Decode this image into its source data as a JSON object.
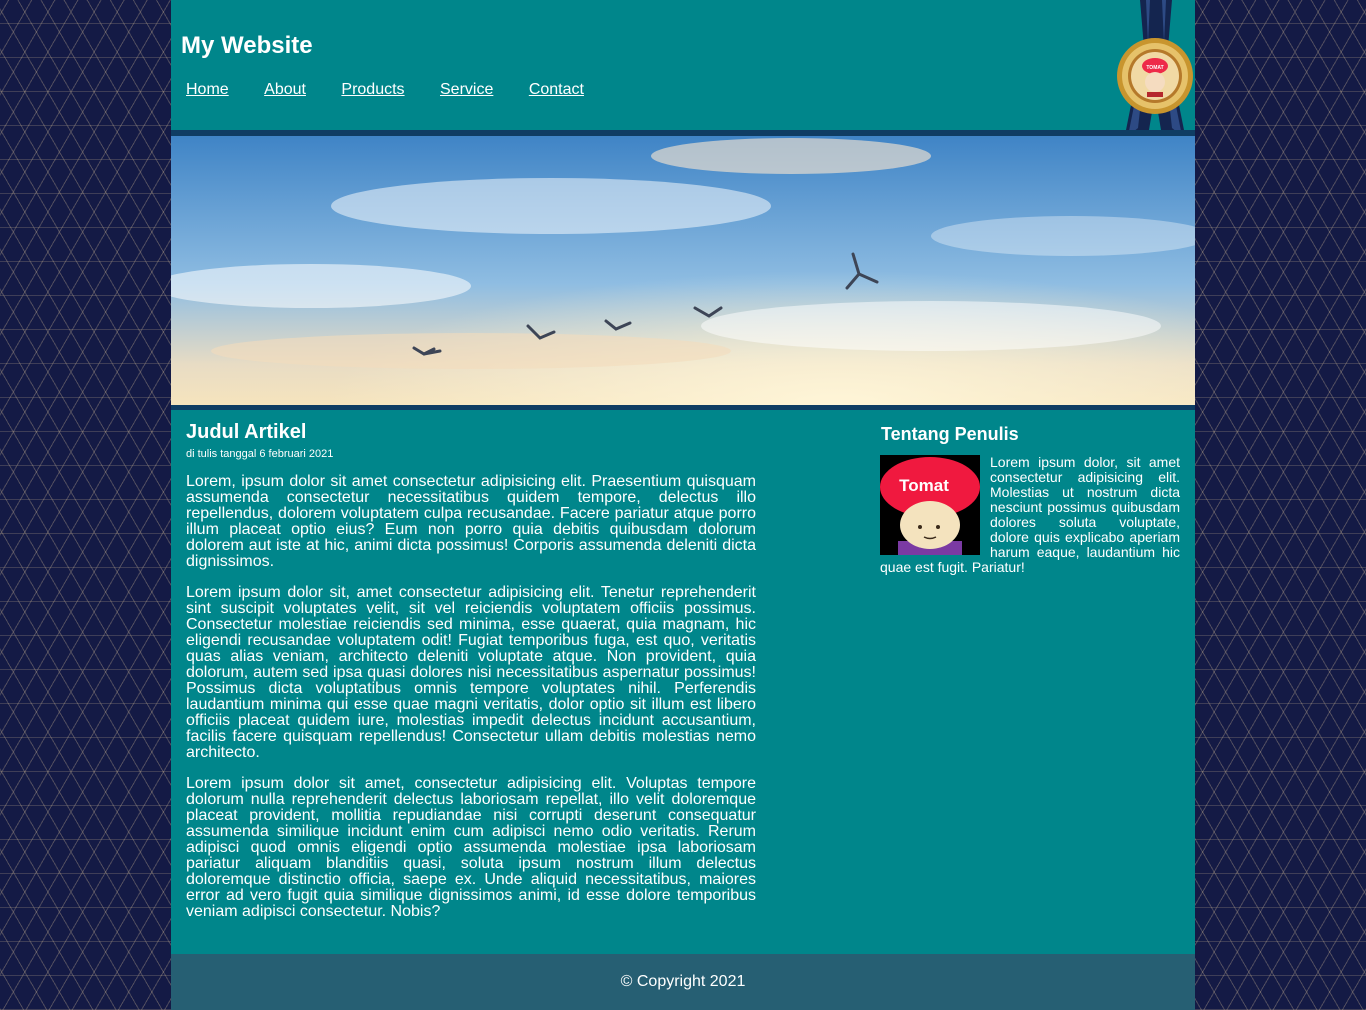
{
  "header": {
    "title": "My Website",
    "nav": [
      "Home",
      "About",
      "Products",
      "Service",
      "Contact"
    ],
    "badge_text": "TOMAT"
  },
  "article": {
    "title": "Judul Artikel",
    "date": "di tulis tanggal 6 februari 2021",
    "paragraphs": [
      "Lorem, ipsum dolor sit amet consectetur adipisicing elit. Praesentium quisquam assumenda consectetur necessitatibus quidem tempore, delectus illo repellendus, dolorem voluptatem culpa recusandae. Facere pariatur atque porro illum placeat optio eius? Eum non porro quia debitis quibusdam dolorum dolorem aut iste at hic, animi dicta possimus! Corporis assumenda deleniti dicta dignissimos.",
      "Lorem ipsum dolor sit, amet consectetur adipisicing elit. Tenetur reprehenderit sint suscipit voluptates velit, sit vel reiciendis voluptatem officiis possimus. Consectetur molestiae reiciendis sed minima, esse quaerat, quia magnam, hic eligendi recusandae voluptatem odit! Fugiat temporibus fuga, est quo, veritatis quas alias veniam, architecto deleniti voluptate atque. Non provident, quia dolorum, autem sed ipsa quasi dolores nisi necessitatibus aspernatur possimus! Possimus dicta voluptatibus omnis tempore voluptates nihil. Perferendis laudantium minima qui esse quae magni veritatis, dolor optio sit illum est libero officiis placeat quidem iure, molestias impedit delectus incidunt accusantium, facilis facere quisquam repellendus! Consectetur ullam debitis molestias nemo architecto.",
      "Lorem ipsum dolor sit amet, consectetur adipisicing elit. Voluptas tempore dolorum nulla reprehenderit delectus laboriosam repellat, illo velit doloremque placeat provident, mollitia repudiandae nisi corrupti deserunt consequatur assumenda similique incidunt enim cum adipisci nemo odio veritatis. Rerum adipisci quod omnis eligendi optio assumenda molestiae ipsa laboriosam pariatur aliquam blanditiis quasi, soluta ipsum nostrum illum delectus doloremque distinctio officia, saepe ex. Unde aliquid necessitatibus, maiores error ad vero fugit quia similique dignissimos animi, id esse dolore temporibus veniam adipisci consectetur. Nobis?"
    ]
  },
  "sidebar": {
    "title": "Tentang Penulis",
    "avatar_label": "Tomat",
    "bio": "Lorem ipsum dolor, sit amet consectetur adipisicing elit. Molestias ut nostrum dicta nesciunt possimus quibusdam dolores soluta voluptate, dolore quis explicabo aperiam harum eaque, laudantium hic quae est fugit. Pariatur!"
  },
  "footer": {
    "copyright": "© Copyright 2021"
  },
  "colors": {
    "teal": "#00868b",
    "navy": "#0f3d63",
    "footer": "#265f73",
    "page_bg": "#141a45"
  }
}
